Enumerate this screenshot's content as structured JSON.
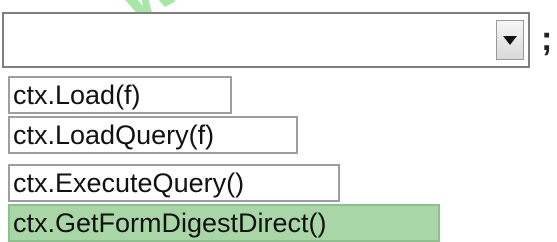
{
  "watermark": "W",
  "combo": {
    "value": "",
    "trailing_text": ";"
  },
  "options": [
    {
      "label": "ctx.Load(f)",
      "selected": false
    },
    {
      "label": "ctx.LoadQuery(f)",
      "selected": false
    },
    {
      "label": "ctx.ExecuteQuery()",
      "selected": false
    },
    {
      "label": "ctx.GetFormDigestDirect()",
      "selected": true
    }
  ],
  "colors": {
    "selected_bg": "#a9d6a6",
    "watermark": "#8be08b"
  }
}
